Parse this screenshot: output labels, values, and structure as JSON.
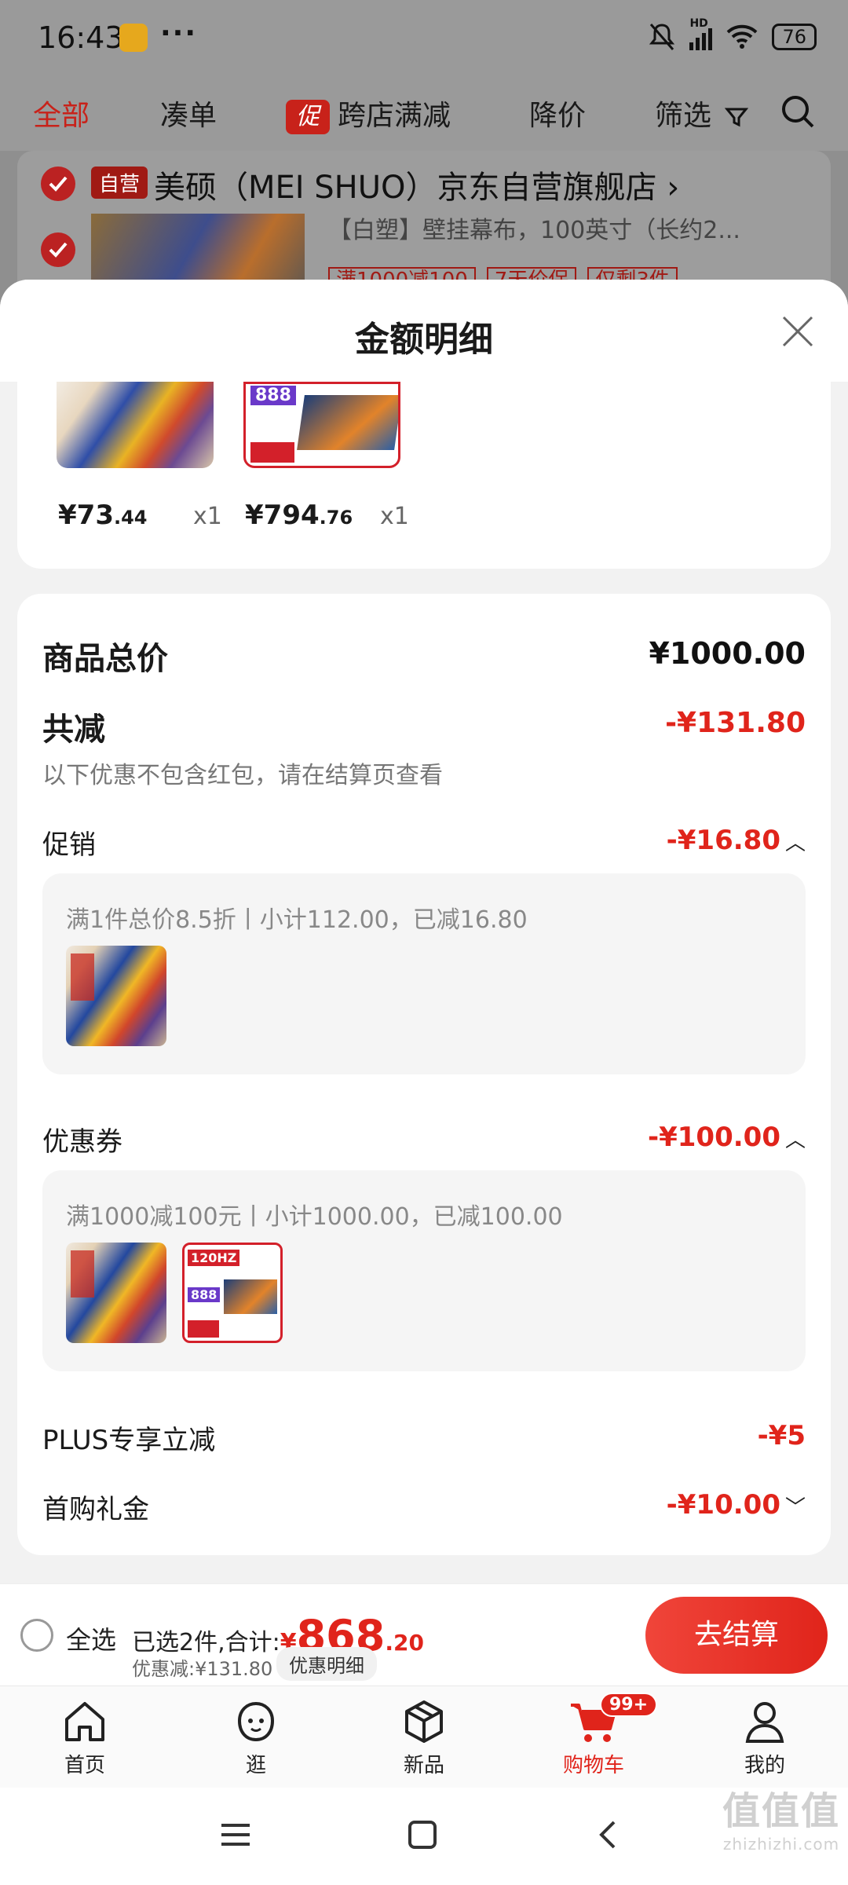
{
  "status_bar": {
    "time": "16:43",
    "dots": "···",
    "signal": "HD",
    "battery": "76"
  },
  "filter_bar": {
    "all": "全部",
    "bundle": "凑单",
    "promo_badge": "促",
    "cross_store": "跨店满减",
    "price_drop": "降价",
    "filter": "筛选"
  },
  "background_store": {
    "self_run": "自营",
    "name": "美硕（MEI SHUO）京东自营旗舰店 ›",
    "desc": "【白塑】壁挂幕布，100英寸（长约2...",
    "tags": [
      "满1000减100",
      "7天价保",
      "仅剩3件"
    ]
  },
  "sheet": {
    "title": "金额明细",
    "items": [
      {
        "price_int": "¥73",
        "price_dec": ".44",
        "qty": "x1"
      },
      {
        "price_int": "¥794",
        "price_dec": ".76",
        "qty": "x1"
      }
    ],
    "monitor_thumb_text": "888",
    "subtotal_label": "商品总价",
    "subtotal_value": "¥1000.00",
    "total_discount_label": "共减",
    "total_discount_value": "-¥131.80",
    "discount_note": "以下优惠不包含红包，请在结算页查看",
    "promo_label": "促销",
    "promo_value": "-¥16.80",
    "promo_desc": "满1件总价8.5折丨小计112.00，已减16.80",
    "coupon_label": "优惠券",
    "coupon_value": "-¥100.00",
    "coupon_desc": "满1000减100元丨小计1000.00，已减100.00",
    "coupon_thumb_hz": "120HZ",
    "coupon_thumb_888": "888",
    "plus_label": "PLUS专享立减",
    "plus_value": "-¥5",
    "firstbuy_label": "首购礼金",
    "firstbuy_value": "-¥10.00"
  },
  "checkout": {
    "select_all": "全选",
    "selected_prefix": "已选2件,合计:",
    "total_yen": "¥",
    "total_int": "868",
    "total_dec": ".20",
    "discount_text": "优惠减:¥131.80",
    "detail_label": "优惠明细",
    "button": "去结算"
  },
  "tabs": [
    {
      "label": "首页",
      "icon": "home-icon"
    },
    {
      "label": "逛",
      "icon": "stroll-icon"
    },
    {
      "label": "新品",
      "icon": "new-products-icon"
    },
    {
      "label": "购物车",
      "icon": "cart-icon",
      "badge": "99+"
    },
    {
      "label": "我的",
      "icon": "profile-icon"
    }
  ],
  "watermark": {
    "main": "值值值",
    "sub": "zhizhizhi.com"
  },
  "colors": {
    "accent": "#e0241b",
    "background": "#f2f2f2"
  }
}
